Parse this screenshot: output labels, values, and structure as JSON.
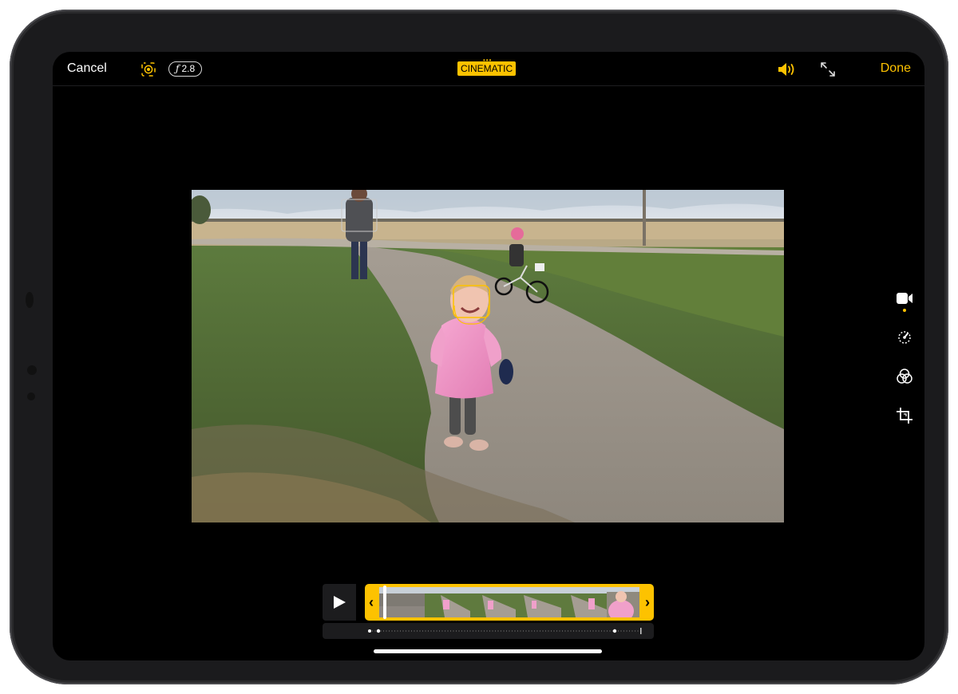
{
  "toolbar": {
    "cancel_label": "Cancel",
    "aperture_label": "2.8",
    "aperture_prefix": "ƒ",
    "mode_label": "CINEMATIC",
    "done_label": "Done"
  },
  "colors": {
    "accent": "#fdc200",
    "background": "#000000"
  },
  "icons": {
    "focus": "focus-icon",
    "audio": "speaker-icon",
    "expand": "expand-icon",
    "video_tool": "video-camera-icon",
    "adjust_tool": "adjust-dial-icon",
    "filters_tool": "filters-icon",
    "crop_tool": "crop-rotate-icon",
    "play": "play-icon"
  },
  "playback": {
    "state": "paused",
    "playhead_fraction": 0.02
  },
  "sidebar": {
    "selected": "video"
  }
}
